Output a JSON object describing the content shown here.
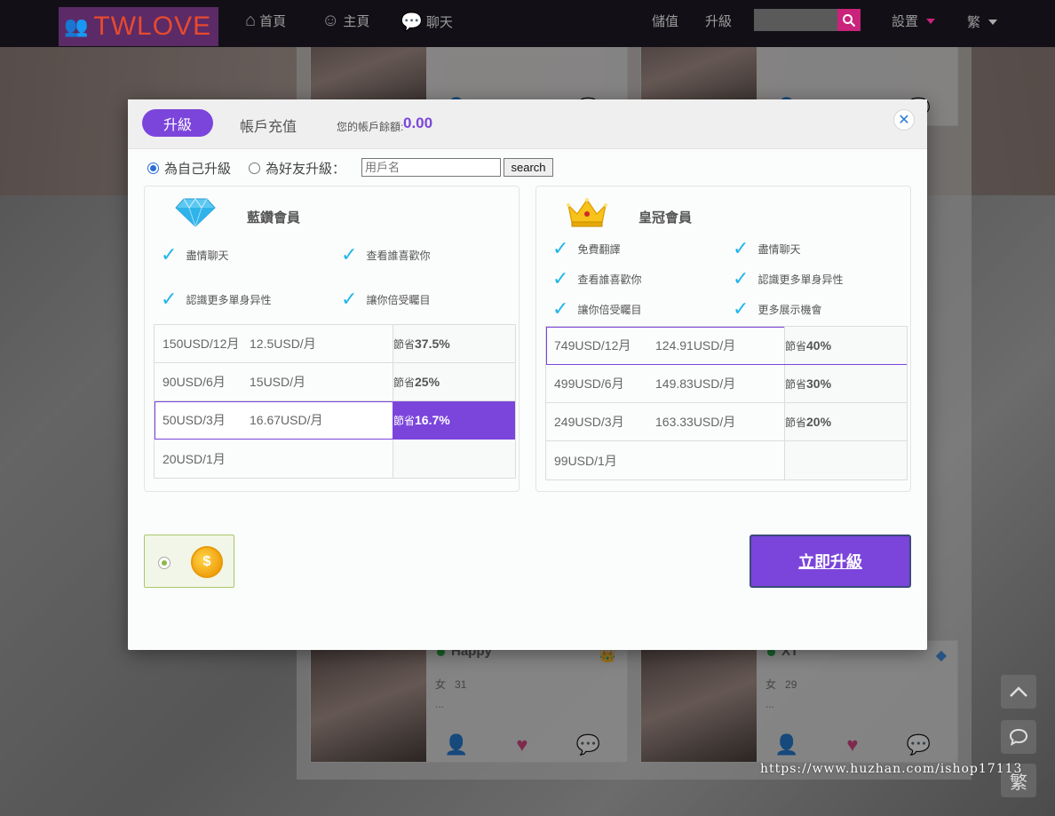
{
  "nav": {
    "logo_text": "TWLOVE",
    "home": "首頁",
    "profile": "主頁",
    "chat": "聊天",
    "deposit": "儲值",
    "upgrade": "升級",
    "settings": "設置",
    "language": "繁",
    "search_placeholder": ""
  },
  "modal": {
    "tab_upgrade": "升級",
    "tab_recharge": "帳戶充值",
    "balance_label": "您的帳戶餘額:",
    "balance_value": "0.00",
    "self_upgrade": "為自己升級",
    "friend_upgrade": "為好友升級：",
    "friend_input_placeholder": "用戶名",
    "search_button": "search",
    "upgrade_now": "立即升級"
  },
  "plans": {
    "blue": {
      "title": "藍鑽會員",
      "features": [
        "盡情聊天",
        "查看誰喜歡你",
        "認識更多單身异性",
        "讓你倍受矚目"
      ],
      "prices": [
        {
          "total": "150USD/12月",
          "monthly": "12.5USD/月",
          "save_label": "節省",
          "save_value": "37.5%"
        },
        {
          "total": "90USD/6月",
          "monthly": "15USD/月",
          "save_label": "節省",
          "save_value": "25%"
        },
        {
          "total": "50USD/3月",
          "monthly": "16.67USD/月",
          "save_label": "節省",
          "save_value": "16.7%"
        },
        {
          "total": "20USD/1月",
          "monthly": "",
          "save_label": "",
          "save_value": ""
        }
      ]
    },
    "crown": {
      "title": "皇冠會員",
      "features": [
        "免費翻譯",
        "盡情聊天",
        "查看誰喜歡你",
        "認識更多單身异性",
        "讓你倍受矚目",
        "更多展示機會"
      ],
      "prices": [
        {
          "total": "749USD/12月",
          "monthly": "124.91USD/月",
          "save_label": "節省",
          "save_value": "40%"
        },
        {
          "total": "499USD/6月",
          "monthly": "149.83USD/月",
          "save_label": "節省",
          "save_value": "30%"
        },
        {
          "total": "249USD/3月",
          "monthly": "163.33USD/月",
          "save_label": "節省",
          "save_value": "20%"
        },
        {
          "total": "99USD/1月",
          "monthly": "",
          "save_label": "",
          "save_value": ""
        }
      ]
    }
  },
  "feed": {
    "cards": [
      {
        "name": "Happy",
        "gender": "女",
        "age": "31",
        "desc": "...",
        "badge": "crown-icon"
      },
      {
        "name": "XT",
        "gender": "女",
        "age": "29",
        "desc": "...",
        "badge": "diamond-icon"
      }
    ]
  },
  "watermark": "https://www.huzhan.com/ishop17113",
  "colors": {
    "accent": "#7b45dc",
    "nav_bg": "#121016",
    "logo_text": "#e64a2e",
    "search_btn": "#c9237b",
    "check": "#23b6e8"
  }
}
